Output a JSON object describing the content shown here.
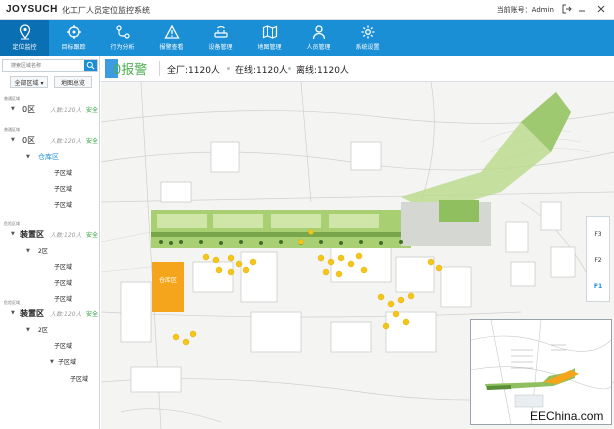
{
  "header": {
    "brand": "JOYSUCH",
    "title": "化工厂人员定位监控系统",
    "account_label": "当前账号：Admin"
  },
  "nav": [
    {
      "label": "定位监控",
      "icon": "location-pin-icon"
    },
    {
      "label": "目标跟踪",
      "icon": "crosshair-icon"
    },
    {
      "label": "行为分析",
      "icon": "route-icon"
    },
    {
      "label": "报警查看",
      "icon": "warning-icon"
    },
    {
      "label": "设备管理",
      "icon": "router-icon"
    },
    {
      "label": "地图管理",
      "icon": "map-icon"
    },
    {
      "label": "人员管理",
      "icon": "person-icon"
    },
    {
      "label": "系统设置",
      "icon": "gear-icon"
    }
  ],
  "left": {
    "search_placeholder": "搜索区域名称",
    "all_regions": "全部区域 ▾",
    "map_overview": "地图总览",
    "tree": [
      {
        "section": "普通区域",
        "label": "0区",
        "count": "人数:120人",
        "status": "安全"
      },
      {
        "section": "普通区域",
        "label": "0区",
        "count": "人数:120人",
        "status": "安全",
        "child": "仓库区",
        "grandchildren": [
          "子区域",
          "子区域",
          "子区域"
        ]
      },
      {
        "section": "危险区域",
        "label": "装置区",
        "count": "人数:120人",
        "status": "安全",
        "child": "2区",
        "grandchildren": [
          "子区域",
          "子区域",
          "子区域"
        ]
      },
      {
        "section": "危险区域",
        "label": "装置区",
        "count": "人数:120人",
        "status": "安全",
        "child": "2区",
        "grandchildren": [
          "子区域",
          "子区域"
        ],
        "leaf": "子区域"
      }
    ]
  },
  "status": {
    "alarm": "0报警",
    "total": "全厂:1120人",
    "online": "在线:1120人",
    "offline": "离线:1120人"
  },
  "map": {
    "warehouse_label": "仓库区",
    "floors": [
      "F3",
      "F2",
      "F1"
    ],
    "active_floor": "F1"
  },
  "watermark": "EEChina.com",
  "colors": {
    "nav": "#1a8fd6",
    "safe": "#2a9d3a",
    "alarm": "#4caf50",
    "warehouse": "#f4a51c",
    "marker": "#f5c518"
  }
}
